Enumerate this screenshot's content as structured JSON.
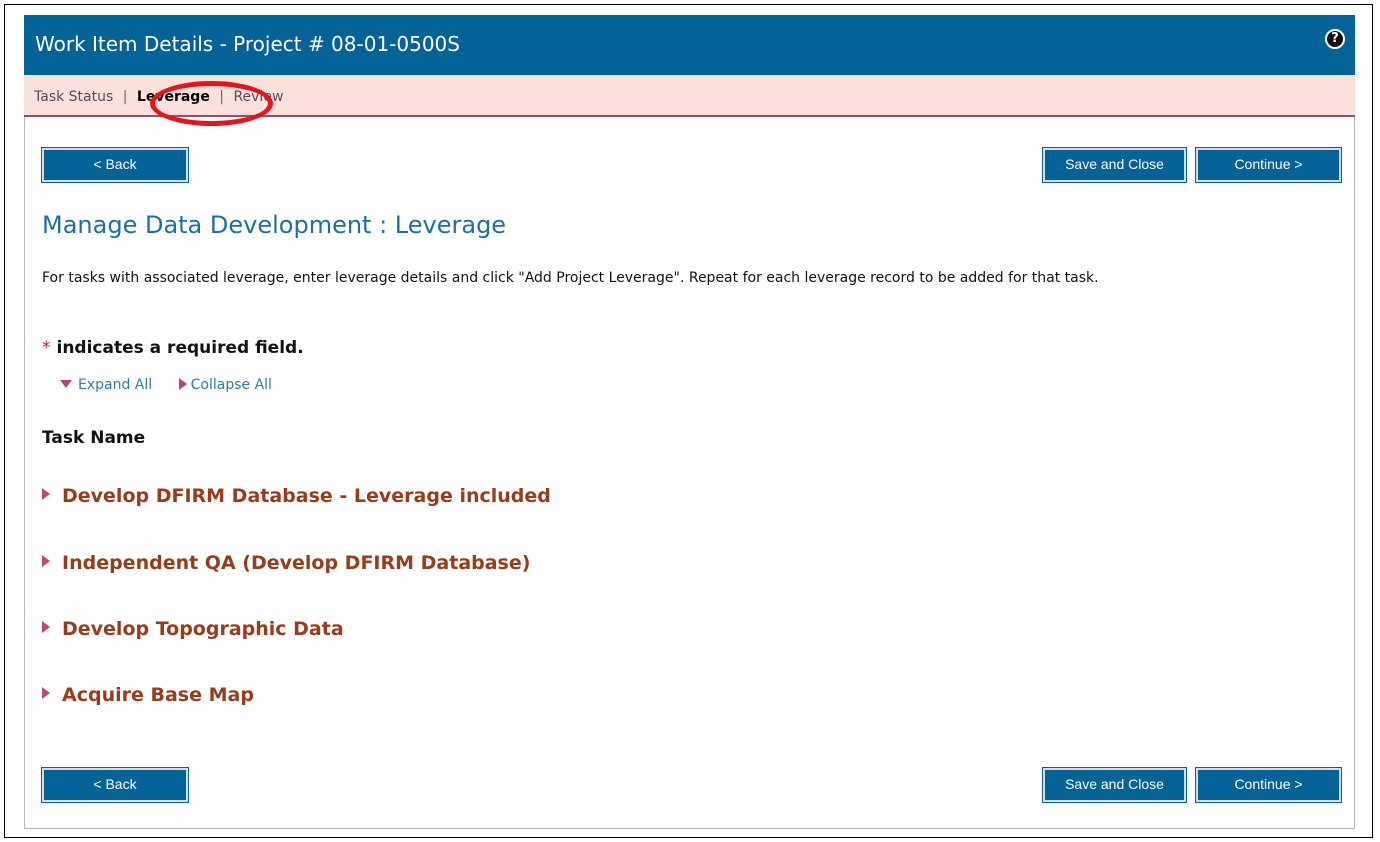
{
  "header": {
    "title": "Work Item Details - Project # 08-01-0500S",
    "help_icon": "question-mark-circle-icon"
  },
  "tabs": [
    {
      "label": "Task Status",
      "active": false
    },
    {
      "label": "Leverage",
      "active": true
    },
    {
      "label": "Review",
      "active": false
    }
  ],
  "tab_separator": "|",
  "buttons": {
    "back": "< Back",
    "save_close": "Save and Close",
    "continue": "Continue >"
  },
  "main": {
    "heading": "Manage Data Development : Leverage",
    "instructions": "For tasks with associated leverage, enter leverage details and click \"Add Project Leverage\". Repeat for each leverage record to be added for that task.",
    "required_star": "*",
    "required_note": "indicates a required field.",
    "expand_all": "Expand All",
    "collapse_all": "Collapse All",
    "task_header": "Task Name",
    "tasks": [
      {
        "name": "Develop DFIRM Database - Leverage included"
      },
      {
        "name": "Independent QA (Develop DFIRM Database)"
      },
      {
        "name": "Develop Topographic Data"
      },
      {
        "name": "Acquire Base Map"
      }
    ]
  },
  "colors": {
    "header_bg": "#036397",
    "tab_bar_bg": "#fbe1dc",
    "task_link": "#993c1c",
    "heading": "#1d6f9e",
    "annotation": "#e5161b"
  }
}
